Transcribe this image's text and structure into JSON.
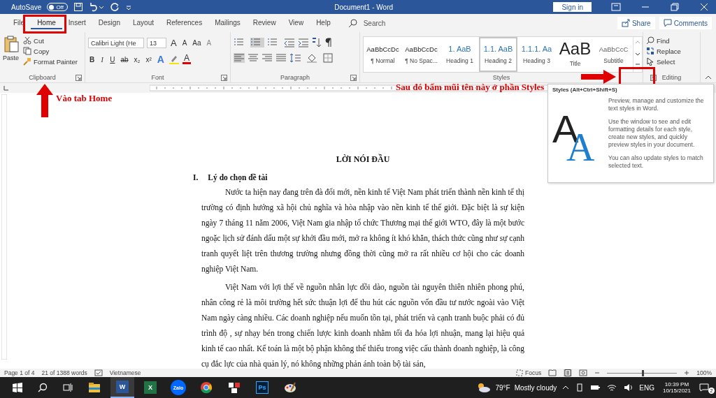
{
  "title_bar": {
    "autosave_label": "AutoSave",
    "autosave": {
      "on": false,
      "label": "Off"
    },
    "title": "Document1 - Word",
    "sign_in": "Sign in"
  },
  "tabs": [
    {
      "label": "File",
      "selected": false
    },
    {
      "label": "Home",
      "selected": true
    },
    {
      "label": "Insert",
      "selected": false
    },
    {
      "label": "Design",
      "selected": false
    },
    {
      "label": "Layout",
      "selected": false
    },
    {
      "label": "References",
      "selected": false
    },
    {
      "label": "Mailings",
      "selected": false
    },
    {
      "label": "Review",
      "selected": false
    },
    {
      "label": "View",
      "selected": false
    },
    {
      "label": "Help",
      "selected": false
    }
  ],
  "search": {
    "placeholder": "Search"
  },
  "share": "Share",
  "comments": "Comments",
  "clipboard": {
    "paste": "Paste",
    "cut": "Cut",
    "copy": "Copy",
    "format_painter": "Format Painter",
    "label": "Clipboard"
  },
  "font": {
    "font_name": "Calibri Light (He",
    "font_size": "13",
    "grow": "A",
    "shrink": "A",
    "case_button": "Aa",
    "clear": "A",
    "effects": "A",
    "color_button": "A",
    "format_buttons": [
      "B",
      "I",
      "U",
      "ab",
      "x₂",
      "x²"
    ],
    "label": "Font"
  },
  "paragraph": {
    "label": "Paragraph"
  },
  "styles": {
    "items": [
      {
        "preview": "AaBbCcDc",
        "name": "¶ Normal",
        "kind": "body",
        "selected": false
      },
      {
        "preview": "AaBbCcDc",
        "name": "¶ No Spac...",
        "kind": "body",
        "selected": false
      },
      {
        "preview": "1.  AaB",
        "name": "Heading 1",
        "kind": "heading",
        "selected": false
      },
      {
        "preview": "1.1.  AaB",
        "name": "Heading 2",
        "kind": "heading",
        "selected": true
      },
      {
        "preview": "1.1.1.  Aa",
        "name": "Heading 3",
        "kind": "heading",
        "selected": false
      },
      {
        "preview": "AaB",
        "name": "Title",
        "kind": "title",
        "selected": false
      },
      {
        "preview": "AaBbCcC",
        "name": "Subtitle",
        "kind": "subtitle",
        "selected": false
      }
    ],
    "label": "Styles"
  },
  "editing": {
    "find": "Find",
    "replace": "Replace",
    "select": "Select",
    "label": "Editing"
  },
  "annotations": {
    "home_caption": "Vào tab Home",
    "styles_caption": "Sau đó bấm mũi tên này ở phần Styles"
  },
  "tooltip": {
    "title": "Styles (Alt+Ctrl+Shift+S)",
    "art_letters": [
      "A",
      "A"
    ],
    "paragraphs": [
      "Preview, manage and customize the text styles in Word.",
      "Use the window to see and edit formatting details for each style, create new styles, and quickly preview styles in your document.",
      "You can also update styles to match selected text."
    ]
  },
  "document": {
    "title": "LỜI NÓI ĐẦU",
    "heading": {
      "number": "I.",
      "text": "Lý do chọn đề tài"
    },
    "paragraphs": [
      "Nước ta hiện nay đang trên đà đổi mới, nền kinh tế Việt Nam phát triển thành nền kinh tế thị trường có định hướng xã hội chủ nghĩa và hòa nhập vào nền kinh tế thế giới. Đặc biệt là sự kiện ngày 7 tháng 11 năm 2006, Việt Nam gia nhập tổ chức Thương mại thế giới WTO, đây là một bước ngoặc lịch sử đánh dấu một sự khởi đầu mới, mở ra không ít khó khăn, thách thức cũng như sự cạnh tranh quyết liệt trên thương trường nhưng đồng thời cũng mở ra rất nhiều cơ hội cho các doanh nghiệp Việt Nam.",
      "Việt Nam với lợi thế về nguồn nhân lực dồi dào, nguồn tài nguyên thiên nhiên phong phú, nhân công rẻ là môi trường hết sức thuận lợi để thu hút các nguồn vốn đầu tư nước ngoài vào Việt Nam ngày càng nhiều. Các doanh nghiệp nếu muốn tồn tại, phát triển và cạnh tranh buộc phải có đủ trình độ , sự nhạy bén trong chiến lược kinh doanh nhằm tối đa hóa lợi nhuận, mang lại hiệu quả kinh tế cao nhất. Kế toán là một bộ phận không thể thiếu trong việc cấu thành doanh nghiệp, là công cụ đắc lực của nhà quản lý, nó không những phản ánh toàn bộ tài sản,"
    ]
  },
  "status_bar": {
    "page": "Page 1 of 4",
    "words": "21 of 1388 words",
    "language": "Vietnamese",
    "focus": "Focus",
    "zoom_slider": {
      "level": 0.5
    },
    "zoom": "100%"
  },
  "taskbar": {
    "apps": [
      {
        "kind": "explorer"
      },
      {
        "kind": "word",
        "label": "W"
      },
      {
        "kind": "excel",
        "label": "X"
      },
      {
        "kind": "zalo",
        "label": "Zalo"
      },
      {
        "kind": "chrome"
      },
      {
        "kind": "generic"
      },
      {
        "kind": "ps",
        "label": "Ps"
      },
      {
        "kind": "paint"
      }
    ],
    "temperature": "79°F",
    "weather": "Mostly cloudy",
    "language": "ENG",
    "time": "10:39 PM",
    "date": "10/15/2021",
    "notifications": "2"
  }
}
